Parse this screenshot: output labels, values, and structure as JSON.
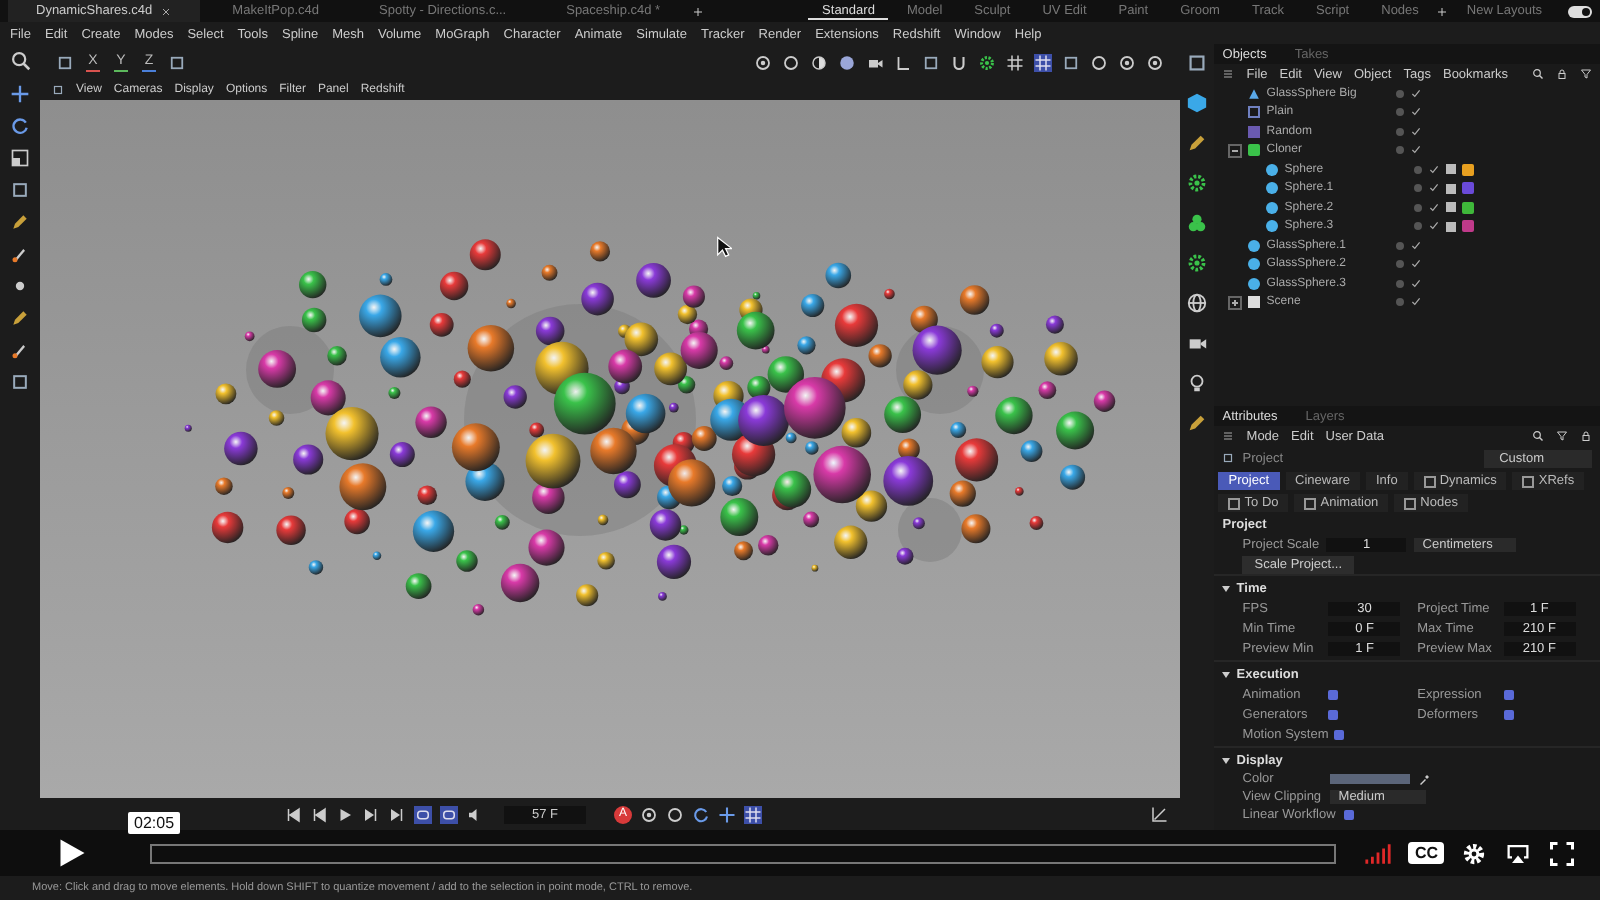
{
  "file_tabs": [
    {
      "label": "DynamicShares.c4d",
      "selected": true
    },
    {
      "label": "MakeItPop.c4d",
      "selected": false
    },
    {
      "label": "Spotty - Directions.c...",
      "selected": false
    },
    {
      "label": "Spaceship.c4d *",
      "selected": false
    }
  ],
  "layout_tabs": [
    {
      "label": "Standard",
      "selected": true
    },
    {
      "label": "Model",
      "selected": false
    },
    {
      "label": "Sculpt",
      "selected": false
    },
    {
      "label": "UV Edit",
      "selected": false
    },
    {
      "label": "Paint",
      "selected": false
    },
    {
      "label": "Groom",
      "selected": false
    },
    {
      "label": "Track",
      "selected": false
    },
    {
      "label": "Script",
      "selected": false
    },
    {
      "label": "Nodes",
      "selected": false
    }
  ],
  "new_layouts": {
    "label": "New Layouts",
    "on": true
  },
  "menu_bar": [
    "File",
    "Edit",
    "Create",
    "Modes",
    "Select",
    "Tools",
    "Spline",
    "Mesh",
    "Volume",
    "MoGraph",
    "Character",
    "Animate",
    "Simulate",
    "Tracker",
    "Render",
    "Extensions",
    "Redshift",
    "Window",
    "Help"
  ],
  "axis_buttons": [
    {
      "label": "X",
      "color": "#d9534f"
    },
    {
      "label": "Y",
      "color": "#5cb85c"
    },
    {
      "label": "Z",
      "color": "#4a7fd9"
    }
  ],
  "viewport_menu": [
    "View",
    "Cameras",
    "Display",
    "Options",
    "Filter",
    "Panel",
    "Redshift"
  ],
  "timeline": {
    "record_label": "A",
    "frame": "57 F"
  },
  "objects_panel": {
    "tabs": [
      {
        "label": "Objects",
        "selected": true
      },
      {
        "label": "Takes",
        "selected": false
      }
    ],
    "menu": [
      "File",
      "Edit",
      "View",
      "Object",
      "Tags",
      "Bookmarks"
    ],
    "objects": [
      {
        "name": "GlassSphere Big",
        "kind": "figure"
      },
      {
        "name": "Plain",
        "kind": "plain"
      },
      {
        "name": "Random",
        "kind": "effector"
      },
      {
        "name": "Cloner",
        "kind": "cloner",
        "expanded": true,
        "children": [
          {
            "name": "Sphere",
            "kind": "sphere",
            "color": "#e8a020"
          },
          {
            "name": "Sphere.1",
            "kind": "sphere",
            "color": "#6a4ad8"
          },
          {
            "name": "Sphere.2",
            "kind": "sphere",
            "color": "#3fb83a"
          },
          {
            "name": "Sphere.3",
            "kind": "sphere",
            "color": "#c03a8a"
          }
        ]
      },
      {
        "name": "GlassSphere.1",
        "kind": "sphere"
      },
      {
        "name": "GlassSphere.2",
        "kind": "sphere"
      },
      {
        "name": "GlassSphere.3",
        "kind": "sphere"
      },
      {
        "name": "Scene",
        "kind": "scene",
        "expanded": false
      }
    ]
  },
  "attributes_panel": {
    "tabs": [
      {
        "label": "Attributes",
        "selected": true
      },
      {
        "label": "Layers",
        "selected": false
      }
    ],
    "menu": [
      "Mode",
      "Edit",
      "User Data"
    ],
    "object": "Project",
    "preset": "Custom",
    "sub_tabs": [
      {
        "label": "Project",
        "kind": "tab",
        "selected": true
      },
      {
        "label": "Cineware",
        "kind": "tab",
        "selected": false
      },
      {
        "label": "Info",
        "kind": "tab",
        "selected": false
      },
      {
        "label": "Dynamics",
        "kind": "checkbox",
        "checked": false,
        "selected": false
      },
      {
        "label": "XRefs",
        "kind": "checkbox",
        "checked": false,
        "selected": false
      },
      {
        "label": "To Do",
        "kind": "checkbox",
        "checked": false,
        "selected": false
      },
      {
        "label": "Animation",
        "kind": "checkbox",
        "checked": false,
        "selected": false
      },
      {
        "label": "Nodes",
        "kind": "checkbox",
        "checked": false,
        "selected": false
      }
    ],
    "section": "Project",
    "project_scale": {
      "label": "Project Scale",
      "value": "1",
      "unit": "Centimeters"
    },
    "scale_button": "Scale Project...",
    "groups": [
      {
        "kind": "fields",
        "title": "Time",
        "expanded": true,
        "items": [
          {
            "label": "FPS",
            "value": "30"
          },
          {
            "label": "Project Time",
            "value": "1 F"
          },
          {
            "label": "Min Time",
            "value": "0 F"
          },
          {
            "label": "Max Time",
            "value": "210 F"
          },
          {
            "label": "Preview Min",
            "value": "1 F"
          },
          {
            "label": "Preview Max",
            "value": "210 F"
          }
        ]
      },
      {
        "kind": "checks",
        "title": "Execution",
        "expanded": true,
        "items": [
          {
            "label": "Animation",
            "checked": true
          },
          {
            "label": "Expression",
            "checked": true
          },
          {
            "label": "Generators",
            "checked": true
          },
          {
            "label": "Deformers",
            "checked": true
          },
          {
            "label": "Motion System",
            "checked": true
          }
        ]
      },
      {
        "kind": "display",
        "title": "Display",
        "expanded": true,
        "color": {
          "label": "Color",
          "color": "#5b6579"
        },
        "view_clipping": {
          "label": "View Clipping",
          "value": "Medium"
        },
        "linear_workflow": {
          "label": "Linear Workflow",
          "checked": true
        }
      }
    ]
  },
  "player": {
    "time": "02:05",
    "captions": "CC"
  },
  "status_bar": "Move: Click and drag to move elements. Hold down SHIFT to quantize movement / add to the selection in point mode, CTRL to remove."
}
